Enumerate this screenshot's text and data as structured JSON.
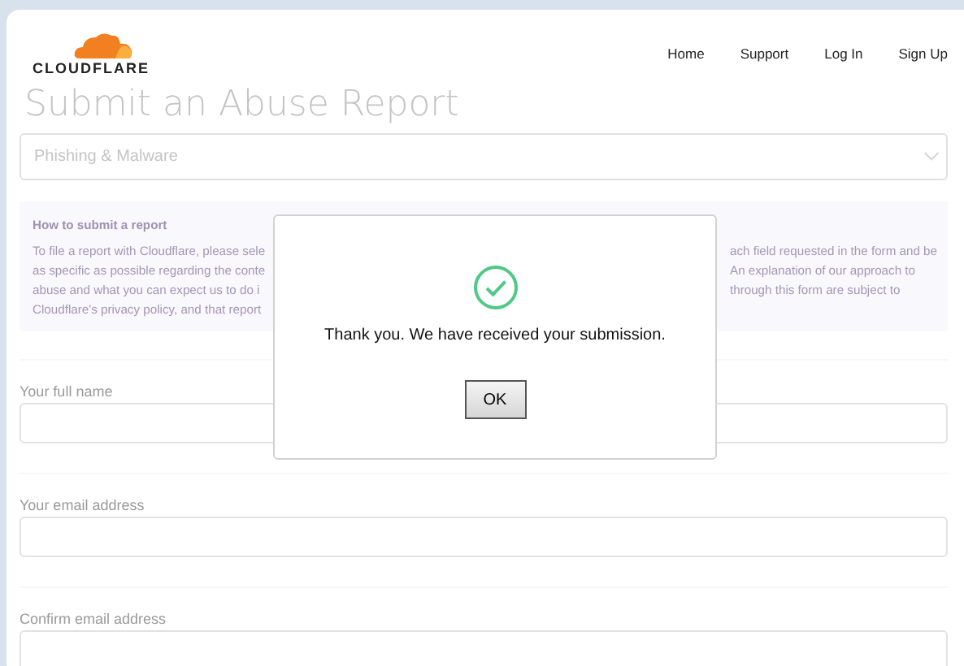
{
  "header": {
    "logo": "CLOUDFLARE",
    "nav": [
      {
        "label": "Home"
      },
      {
        "label": "Support"
      },
      {
        "label": "Log In"
      },
      {
        "label": "Sign Up"
      }
    ]
  },
  "page": {
    "title": "Submit an Abuse Report",
    "report_type": {
      "value": "Phishing & Malware"
    },
    "info": {
      "heading": "How to submit a report",
      "lines": [
        {
          "left": "To file a report with Cloudflare, please sele",
          "right": "ach field requested in the form and be"
        },
        {
          "left": "as specific as possible regarding the conte",
          "right": "An explanation of our approach to"
        },
        {
          "left": "abuse and what you can expect us to do i",
          "right": "through this form are subject to"
        },
        {
          "left": "Cloudflare's privacy policy, and that report"
        }
      ]
    },
    "fields": [
      {
        "label": "Your full name"
      },
      {
        "label": "Your email address"
      },
      {
        "label": "Confirm email address"
      }
    ]
  },
  "dialog": {
    "message": "Thank you. We have received your submission.",
    "button": "OK"
  }
}
